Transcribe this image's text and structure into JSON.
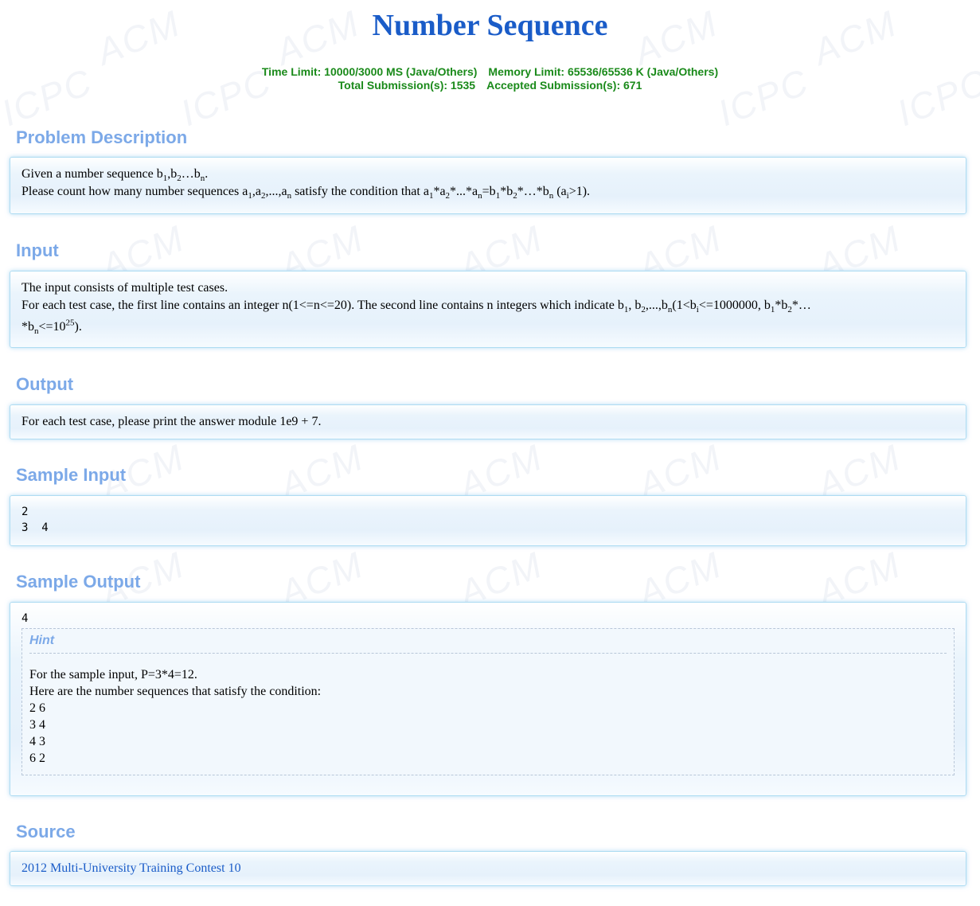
{
  "problem": {
    "title": "Number Sequence",
    "limits_line1_time": "Time Limit: 10000/3000 MS (Java/Others)",
    "limits_line1_memory": "Memory Limit: 65536/65536 K (Java/Others)",
    "limits_line2_total": "Total Submission(s): 1535",
    "limits_line2_accepted": "Accepted Submission(s): 671"
  },
  "sections": {
    "description_title": "Problem Description",
    "input_title": "Input",
    "output_title": "Output",
    "sample_input_title": "Sample Input",
    "sample_output_title": "Sample Output",
    "source_title": "Source"
  },
  "description": {
    "l1_a": "Given a number sequence b",
    "l1_s1": "1",
    "l1_b": ",b",
    "l1_s2": "2",
    "l1_c": "…b",
    "l1_s3": "n",
    "l1_d": ".",
    "l2_a": "Please count how many number sequences a",
    "l2_s1": "1",
    "l2_b": ",a",
    "l2_s2": "2",
    "l2_c": ",...,a",
    "l2_s3": "n",
    "l2_d": " satisfy the condition that a",
    "l2_s4": "1",
    "l2_e": "*a",
    "l2_s5": "2",
    "l2_f": "*...*a",
    "l2_s6": "n",
    "l2_g": "=b",
    "l2_s7": "1",
    "l2_h": "*b",
    "l2_s8": "2",
    "l2_i": "*…*b",
    "l2_s9": "n",
    "l2_j": " (a",
    "l2_s10": "i",
    "l2_k": ">1)."
  },
  "input": {
    "l1": "The input consists of multiple test cases.",
    "l2_a": "For each test case, the first line contains an integer n(1<=n<=20). The second line contains n integers which indicate b",
    "l2_s1": "1",
    "l2_b": ", b",
    "l2_s2": "2",
    "l2_c": ",...,b",
    "l2_s3": "n",
    "l2_d": "(1<b",
    "l2_s4": "i",
    "l2_e": "<=1000000, b",
    "l2_s5": "1",
    "l2_f": "*b",
    "l2_s6": "2",
    "l2_g": "*…",
    "l3_a": "*b",
    "l3_s1": "n",
    "l3_b": "<=10",
    "l3_sup": "25",
    "l3_c": ")."
  },
  "output": {
    "text": "For each test case, please print the answer module 1e9 + 7."
  },
  "sample_input": {
    "text": "2\n3  4"
  },
  "sample_output": {
    "text": "4",
    "hint_title": "Hint",
    "hint_lines": [
      "For the sample input, P=3*4=12.",
      "Here are the number sequences that satisfy the condition:",
      "2 6",
      "3 4",
      "4 3",
      "6 2"
    ]
  },
  "source": {
    "link_text": "2012 Multi-University Training Contest 10"
  },
  "watermarks": [
    "ACM",
    "ICPC"
  ],
  "colors": {
    "title": "#1a5cc8",
    "limits": "#1a8a1a",
    "section_title": "#7ca9e8",
    "panel_border": "#aedcf2",
    "link": "#1a5cc8"
  }
}
